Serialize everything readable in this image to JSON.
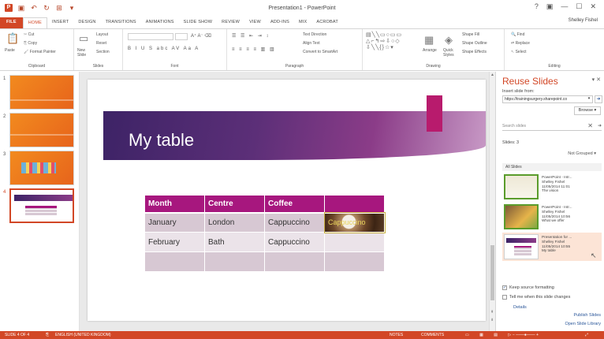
{
  "window": {
    "title": "Presentation1 - PowerPoint",
    "user": "Shelley Fishel",
    "controls": [
      "?",
      "▣",
      "—",
      "☐",
      "✕"
    ]
  },
  "tabs": [
    "FILE",
    "HOME",
    "INSERT",
    "DESIGN",
    "TRANSITIONS",
    "ANIMATIONS",
    "SLIDE SHOW",
    "REVIEW",
    "VIEW",
    "ADD-INS",
    "MIX",
    "ACROBAT"
  ],
  "active_tab": "HOME",
  "ribbon": {
    "clipboard": {
      "label": "Clipboard",
      "paste": "Paste",
      "cut": "Cut",
      "copy": "Copy",
      "format_painter": "Format Painter"
    },
    "slides": {
      "label": "Slides",
      "new_slide": "New Slide",
      "layout": "Layout",
      "reset": "Reset",
      "section": "Section"
    },
    "font": {
      "label": "Font"
    },
    "paragraph": {
      "label": "Paragraph",
      "text_direction": "Text Direction",
      "align_text": "Align Text",
      "convert_smartart": "Convert to SmartArt"
    },
    "drawing": {
      "label": "Drawing",
      "arrange": "Arrange",
      "quick_styles": "Quick Styles",
      "shape_fill": "Shape Fill",
      "shape_outline": "Shape Outline",
      "shape_effects": "Shape Effects"
    },
    "editing": {
      "label": "Editing",
      "find": "Find",
      "replace": "Replace",
      "select": "Select"
    }
  },
  "thumbnails": [
    {
      "num": "1"
    },
    {
      "num": "2"
    },
    {
      "num": "3"
    },
    {
      "num": "4"
    }
  ],
  "slide": {
    "title": "My table",
    "table": {
      "headers": [
        "Month",
        "Centre",
        "Coffee",
        ""
      ],
      "rows": [
        [
          "January",
          "London",
          "Cappuccino",
          "Cappuccino"
        ],
        [
          "February",
          "Bath",
          "Cappuccino",
          ""
        ],
        [
          "",
          "",
          "",
          ""
        ]
      ]
    }
  },
  "pane": {
    "title": "Reuse Slides",
    "insert_from_label": "Insert slide from:",
    "url": "https://trainingsurgery.sharepoint.co",
    "browse": "Browse ▾",
    "search_placeholder": "Search slides",
    "slides_label": "Slides: 3",
    "grouping": "Not Grouped ▾",
    "all_slides": "All Slides",
    "items": [
      {
        "line1": "PowerPoint - Intr...",
        "line2": "Shelley Fishel",
        "line3": "11/05/2014 11:01",
        "line4": "The vision"
      },
      {
        "line1": "PowerPoint - Intr...",
        "line2": "Shelley Fishel",
        "line3": "11/05/2014 10:56",
        "line4": "What we offer"
      },
      {
        "line1": "Presentation for ...",
        "line2": "Shelley Fishel",
        "line3": "11/05/2014 10:55",
        "line4": "My table"
      }
    ],
    "keep_formatting": "Keep source formatting",
    "tell_me": "Tell me when this slide changes",
    "details": "Details",
    "publish": "Publish Slides",
    "open_library": "Open Slide Library"
  },
  "status": {
    "slide_count": "SLIDE 4 OF 4",
    "language": "ENGLISH (UNITED KINGDOM)",
    "notes": "NOTES",
    "comments": "COMMENTS"
  },
  "colors": {
    "accent": "#d24726",
    "table_header": "#a7177e",
    "title_band": "#5c2f78"
  }
}
